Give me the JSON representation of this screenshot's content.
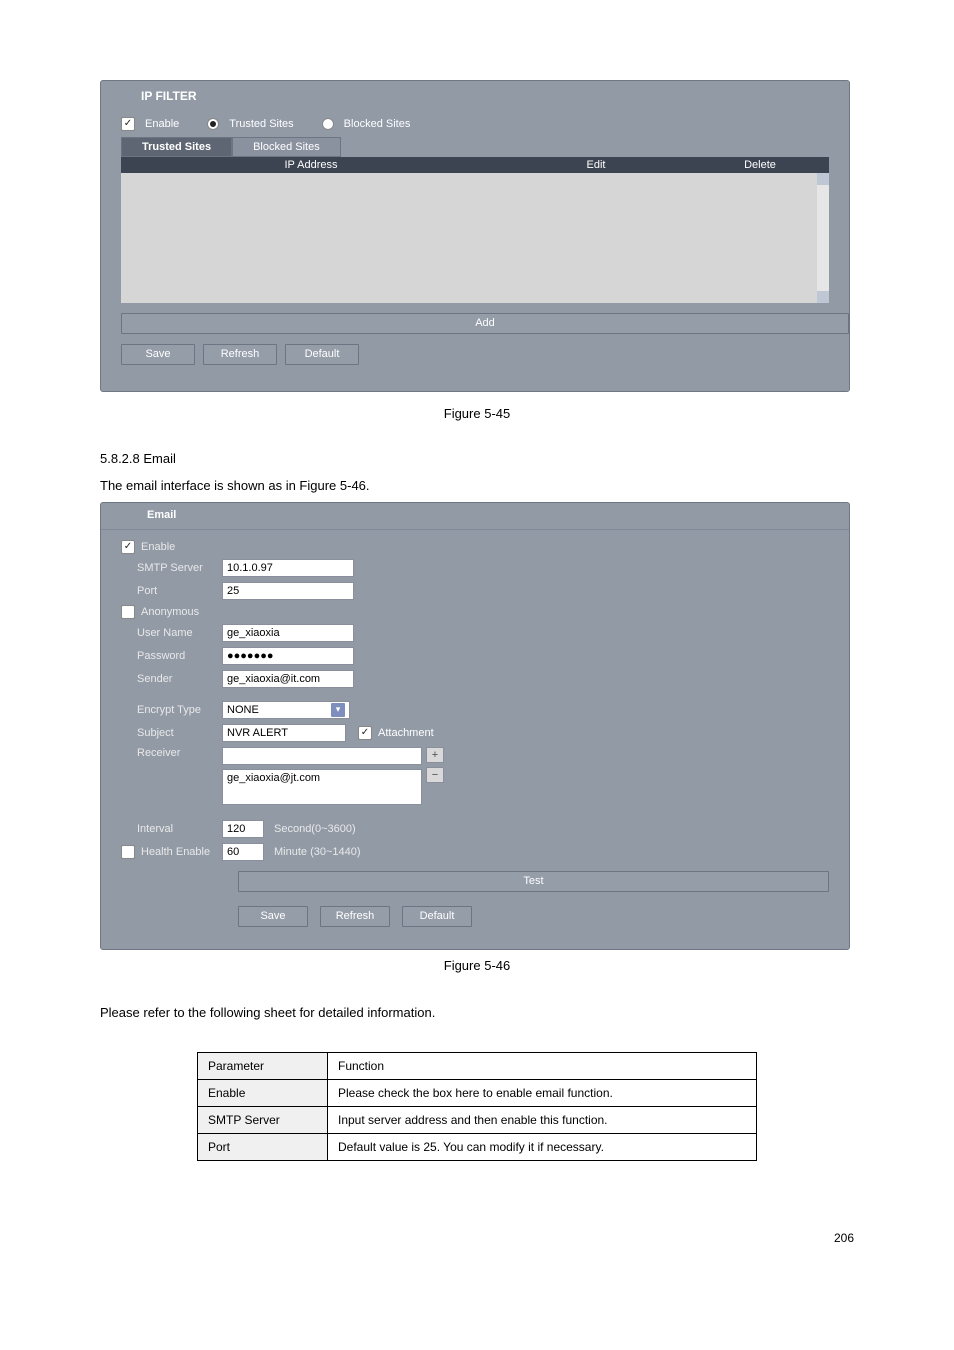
{
  "ip_filter": {
    "title": "IP FILTER",
    "enable_label": "Enable",
    "trusted_radio": "Trusted Sites",
    "blocked_radio": "Blocked Sites",
    "tab_trusted": "Trusted Sites",
    "tab_blocked": "Blocked Sites",
    "col_ip": "IP Address",
    "col_edit": "Edit",
    "col_delete": "Delete",
    "btn_add": "Add",
    "btn_save": "Save",
    "btn_refresh": "Refresh",
    "btn_default": "Default"
  },
  "fig1": "Figure 5-45",
  "sec1": "5.8.2.8 Email",
  "sec1_text": "The email interface is shown as in Figure 5-46.",
  "email": {
    "title": "Email",
    "enable_label": "Enable",
    "smtp_label": "SMTP Server",
    "smtp_value": "10.1.0.97",
    "port_label": "Port",
    "port_value": "25",
    "anon_label": "Anonymous",
    "user_label": "User Name",
    "user_value": "ge_xiaoxia",
    "pwd_label": "Password",
    "pwd_value": "●●●●●●●",
    "sender_label": "Sender",
    "sender_value": "ge_xiaoxia@it.com",
    "encrypt_label": "Encrypt Type",
    "encrypt_value": "NONE",
    "subject_label": "Subject",
    "subject_value": "NVR ALERT",
    "attach_label": "Attachment",
    "receiver_label": "Receiver",
    "receiver_value": "ge_xiaoxia@jt.com",
    "interval_label": "Interval",
    "interval_value": "120",
    "interval_unit": "Second(0~3600)",
    "health_label": "Health Enable",
    "health_value": "60",
    "health_unit": "Minute (30~1440)",
    "btn_test": "Test",
    "btn_save": "Save",
    "btn_refresh": "Refresh",
    "btn_default": "Default"
  },
  "fig2": "Figure 5-46",
  "table_intro": "Please refer to the following sheet for detailed information.",
  "doc_table": {
    "h1": "Parameter",
    "h2": "Function",
    "r1_1": "Enable",
    "r1_2": "Please check the box here to enable email function.",
    "r2_1": "SMTP Server",
    "r2_2": "Input server address and then enable this function.",
    "r3_1": "Port",
    "r3_2": "Default value is 25. You can modify it if necessary."
  },
  "page_num": "206"
}
